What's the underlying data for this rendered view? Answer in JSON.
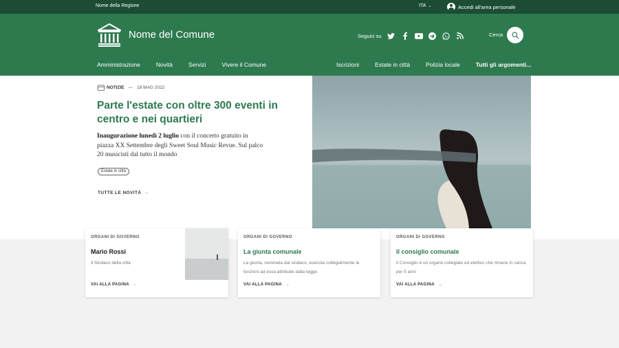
{
  "topbar": {
    "region": "Nome della Regione",
    "lang": "ITA",
    "login": "Accedi all'area personale"
  },
  "header": {
    "site_title": "Nome del Comune",
    "social_label": "Seguici su",
    "search_label": "Cerca"
  },
  "nav": {
    "left": [
      "Amministrazione",
      "Novità",
      "Servizi",
      "Vivere il Comune"
    ],
    "right": [
      "Iscrizioni",
      "Estate in città",
      "Polizia locale",
      "Tutti gli argomenti..."
    ]
  },
  "hero": {
    "category": "NOTIZIE",
    "date": "18 MAG 2022",
    "title": "Parte l'estate con oltre 300 eventi in centro e nei quartieri",
    "desc_bold": "Inaugurazione lunedì 2 luglio",
    "desc_rest": " con il concerto gratuito in piazza XX Settembre degli Sweet Soul Music Revue. Sul palco 20 musicisti dal tutto il mondo",
    "tag": "Estate in città",
    "all_news": "TUTTE LE NOVITÀ"
  },
  "cards": [
    {
      "kicker": "ORGANI DI GOVERNO",
      "title": "Mario Rossi",
      "text": "Il Sindaco della città",
      "link": "VAI ALLA PAGINA"
    },
    {
      "kicker": "ORGANI DI GOVERNO",
      "title": "La giunta comunale",
      "text": "La giunta, nominata dal sindaco, esercita collegialmente le funzioni ad essa attribuite dalla legge.",
      "link": "VAI ALLA PAGINA"
    },
    {
      "kicker": "ORGANI DI GOVERNO",
      "title": "Il consiglio comunale",
      "text": "Il Consiglio è un organo collegiale ed elettivo che rimane in carica per 5 anni",
      "link": "VAI ALLA PAGINA"
    }
  ],
  "colors": {
    "primary": "#2e7a4f",
    "dark": "#1c4d34"
  }
}
